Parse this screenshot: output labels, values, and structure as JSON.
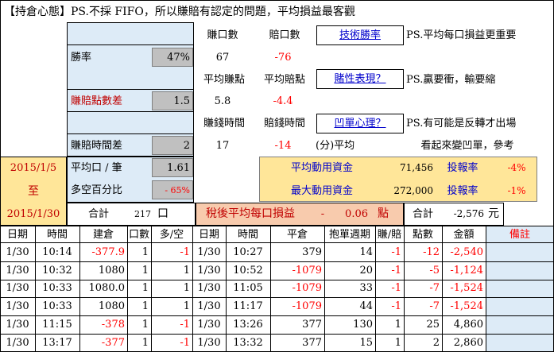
{
  "title": "【持倉心態】PS.不採 FIFO，所以賺賠有認定的問題，平均損益最客觀",
  "stats": {
    "win_rate_label": "勝率",
    "win_rate_value": "47%",
    "pl_diff_label": "賺賠點數差",
    "pl_diff_value": "1.5",
    "time_diff_label": "賺賠時間差",
    "time_diff_value": "2",
    "col_earn_label": "賺口數",
    "col_loss_label": "賠口數",
    "earn_count": "67",
    "loss_count": "-76",
    "avg_earn_label": "平均賺點",
    "avg_loss_label": "平均賠點",
    "avg_earn": "5.8",
    "avg_loss": "-4.4",
    "earn_time_label": "賺錢時間",
    "loss_time_label": "賠錢時間",
    "earn_time": "17",
    "loss_time": "-14",
    "minute_avg_label": "(分)平均"
  },
  "links": {
    "tech_win": "技術勝率",
    "temperament": "賭性表現？",
    "swing": "凹單心理？"
  },
  "notes": {
    "n1": "PS.平均每口損益更重要",
    "n2": "PS.贏要衝，輸要縮",
    "n3": "PS.有可能是反轉才出場",
    "n4": "看起來變凹單，參考"
  },
  "period": {
    "start": "2015/1/5",
    "to": "至",
    "end": "2015/1/30"
  },
  "summary": {
    "avg_lots_label": "平均口 / 筆",
    "avg_lots_value": "1.61",
    "ls_pct_label": "多空百分比",
    "ls_pct_value": "- 65%",
    "total_label": "合計",
    "total_lots": "217",
    "lot_unit": "口",
    "avg_capital_label": "平均動用資金",
    "avg_capital_value": "71,456",
    "roi_label_1": "投報率",
    "roi_value_1": "-4%",
    "max_capital_label": "最大動用資金",
    "max_capital_value": "272,000",
    "roi_label_2": "投報率",
    "roi_value_2": "-1%",
    "after_tax_label": "稅後平均每口損益",
    "after_tax_minus": "-",
    "after_tax_value": "0.06",
    "after_tax_unit": "點",
    "total_label_2": "合計",
    "total_amount": "-2,576",
    "currency_unit": "元"
  },
  "table": {
    "headers": [
      "日期",
      "時間",
      "建倉",
      "口數",
      "多/空",
      "日期",
      "時間",
      "平倉",
      "抱單週期",
      "賺/賠",
      "點數",
      "金額",
      "備註"
    ],
    "rows": [
      [
        "1/30",
        "10:14",
        "-377.9",
        "1",
        "-1",
        "1/30",
        "10:27",
        "379",
        "14",
        "-1",
        "-12",
        "-2,540",
        ""
      ],
      [
        "1/30",
        "10:32",
        "1080",
        "1",
        "1",
        "1/30",
        "10:52",
        "-1079",
        "20",
        "-1",
        "-5",
        "-1,124",
        ""
      ],
      [
        "1/30",
        "10:33",
        "1080.0",
        "1",
        "1",
        "1/30",
        "11:05",
        "-1079",
        "33",
        "-1",
        "-7",
        "-1,524",
        ""
      ],
      [
        "1/30",
        "10:33",
        "1080",
        "1",
        "1",
        "1/30",
        "11:17",
        "-1079",
        "44",
        "-1",
        "-7",
        "-1,524",
        ""
      ],
      [
        "1/30",
        "11:15",
        "-378",
        "1",
        "-1",
        "1/30",
        "13:26",
        "377",
        "130",
        "1",
        "25",
        "4,860",
        ""
      ],
      [
        "1/30",
        "13:17",
        "-377",
        "1",
        "-1",
        "1/30",
        "13:32",
        "377",
        "15",
        "1",
        "2",
        "2,860",
        ""
      ]
    ]
  },
  "colors": {
    "red": "#ff0000",
    "blue_text": "#0000cc",
    "gray_fill": "#c0c0c0",
    "tan_fill": "#ffe699",
    "peach_fill": "#f8cbad",
    "light_blue_fill": "#ddebf7"
  }
}
